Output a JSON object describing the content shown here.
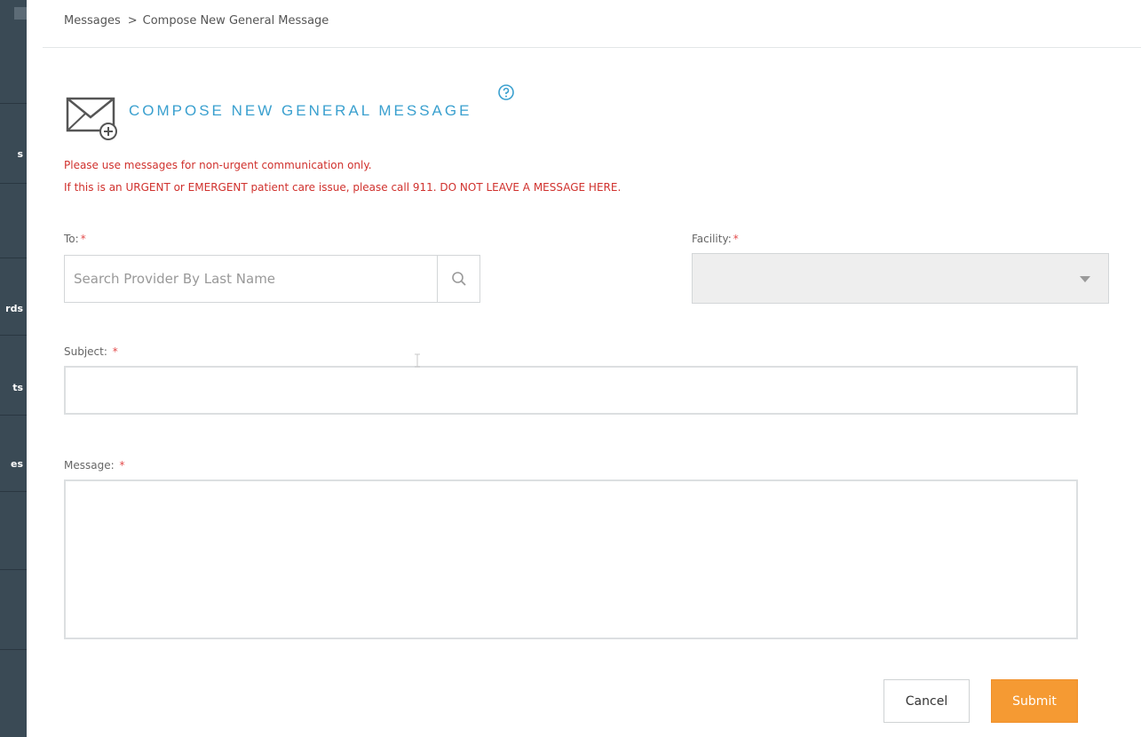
{
  "breadcrumb": {
    "root": "Messages",
    "separator": ">",
    "current": "Compose New General Message"
  },
  "sidebar": {
    "items": [
      {
        "label": "",
        "fragment": "s"
      },
      {
        "label": "",
        "fragment": ""
      },
      {
        "label": "",
        "fragment": "rds"
      },
      {
        "label": "",
        "fragment": "ts"
      },
      {
        "label": "",
        "fragment": "es"
      },
      {
        "label": "",
        "fragment": ""
      },
      {
        "label": "",
        "fragment": ""
      }
    ]
  },
  "header": {
    "title": "COMPOSE NEW GENERAL MESSAGE",
    "icon": "envelope-plus-icon",
    "help_icon": "help-circle-icon"
  },
  "warnings": {
    "line1": "Please use messages for non-urgent communication only.",
    "line2": "If this is an URGENT or EMERGENT patient care issue, please call 911. DO NOT LEAVE A MESSAGE HERE."
  },
  "form": {
    "to": {
      "label": "To:",
      "required": "*",
      "placeholder": "Search Provider By Last Name",
      "value": ""
    },
    "facility": {
      "label": "Facility:",
      "required": "*",
      "selected": ""
    },
    "subject": {
      "label": "Subject:",
      "required": "*",
      "value": ""
    },
    "message": {
      "label": "Message:",
      "required": "*",
      "value": ""
    }
  },
  "actions": {
    "cancel_label": "Cancel",
    "submit_label": "Submit"
  },
  "colors": {
    "accent_blue": "#3aa0cf",
    "warning_red": "#d0312d",
    "submit_orange": "#f59a33",
    "sidebar_bg": "#3a4a55"
  }
}
